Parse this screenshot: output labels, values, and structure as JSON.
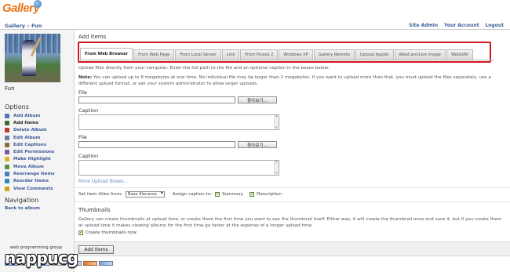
{
  "header": {
    "logo": "Gallery",
    "breadcrumb": [
      "Gallery",
      "Fun"
    ],
    "links": [
      "Site Admin",
      "Your Account",
      "Logout"
    ]
  },
  "sidebar": {
    "album_name": "Fun",
    "options_title": "Options",
    "options": [
      {
        "label": "Add Album",
        "icon": "add-album-icon",
        "color": "#4a78b8"
      },
      {
        "label": "Add Items",
        "icon": "add-items-icon",
        "color": "#3d6a2e"
      },
      {
        "label": "Delete Album",
        "icon": "delete-album-icon",
        "color": "#c0392b"
      },
      {
        "label": "Edit Album",
        "icon": "edit-album-icon",
        "color": "#6b7fa8"
      },
      {
        "label": "Edit Captions",
        "icon": "edit-captions-icon",
        "color": "#8a6d3b"
      },
      {
        "label": "Edit Permissions",
        "icon": "edit-permissions-icon",
        "color": "#7c5aa6"
      },
      {
        "label": "Make Highlight",
        "icon": "make-highlight-icon",
        "color": "#e1b12c"
      },
      {
        "label": "Move Album",
        "icon": "move-album-icon",
        "color": "#5b8f47"
      },
      {
        "label": "Rearrange Items",
        "icon": "rearrange-items-icon",
        "color": "#4a78b8"
      },
      {
        "label": "Reorder Items",
        "icon": "reorder-items-icon",
        "color": "#2d88c0"
      },
      {
        "label": "View Comments",
        "icon": "view-comments-icon",
        "color": "#d4a017"
      }
    ],
    "navigation_title": "Navigation",
    "back_link": "Back to album"
  },
  "main": {
    "title": "Add Items",
    "tabs": [
      "From Web Browser",
      "From Web Page",
      "From Local Server",
      "Link",
      "From Picasa 2",
      "Windows XP",
      "Gallery Remote",
      "Upload Applet",
      "WebCam/Live Image",
      "WebDAV"
    ],
    "active_tab": "From Web Browser",
    "intro": "Upload files directly from your computer. Enter the full path to the file and an optional caption in the boxes below.",
    "note_label": "Note:",
    "note": " You can upload up to 8 megabytes at one time. No individual file may be larger than 2 megabytes. If you want to upload more than that, you must upload the files separately, use a different upload format, or ask your system administrator to allow larger uploads.",
    "file_label": "File",
    "caption_label": "Caption",
    "browse_label": "찾아보기...",
    "file_value": "",
    "caption_value": "",
    "more_link": "More Upload Boxes...",
    "set_titles_label": "Set item titles from:",
    "title_select_value": "Base filename",
    "assign_caption_label": "Assign caption to:",
    "summary_label": "Summary",
    "description_label": "Description",
    "thumbnails_title": "Thumbnails",
    "thumbnails_desc": "Gallery can create thumbnails at upload time, or create them the first time you want to see the thumbnail itself. Either way, it will create the thumbnail once and save it, but if you create them at upload time it makes viewing albums for the first time go faster at the expense of a longer upload time.",
    "create_thumbs_label": "Create thumbnails now",
    "submit_label": "Add Items"
  },
  "watermark": {
    "small": "web programming group",
    "main": "nappucg"
  }
}
